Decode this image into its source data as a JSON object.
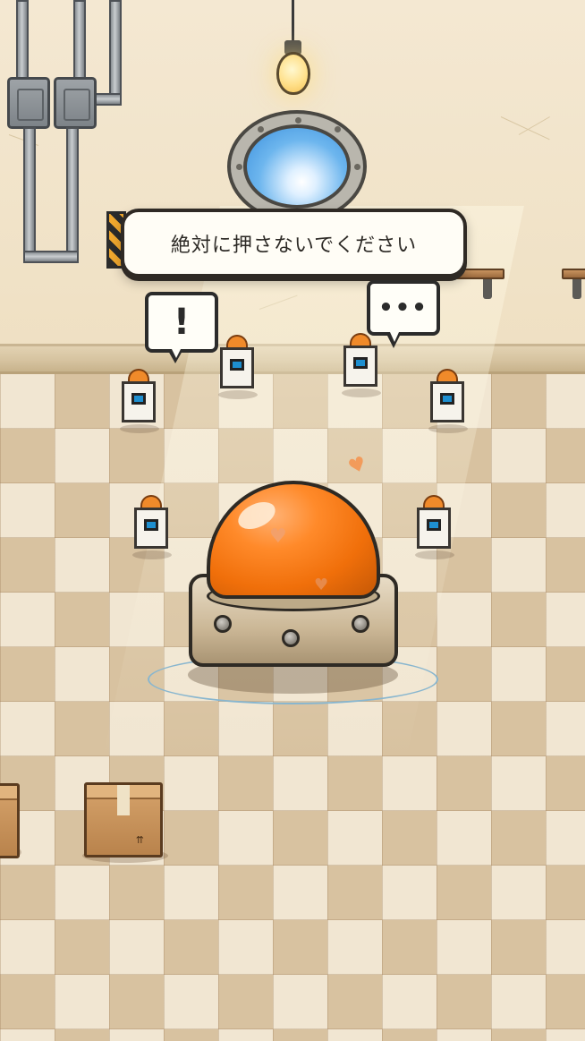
{
  "banner": {
    "text": "絶対に押さないでください"
  },
  "bubbles": {
    "exclaim": "!",
    "dots": "•••"
  },
  "colors": {
    "button_orange": "#f06f0a",
    "bot_eye_blue": "#1e8fd0",
    "bot_cap_orange": "#f08a2a"
  },
  "icons": {
    "button": "big-orange-button",
    "lamp": "hanging-lightbulb",
    "window": "porthole-window",
    "box": "cardboard-box",
    "heart": "heart",
    "robot": "mini-robot"
  },
  "box_mark": "⇈",
  "heart_glyph": "♥"
}
